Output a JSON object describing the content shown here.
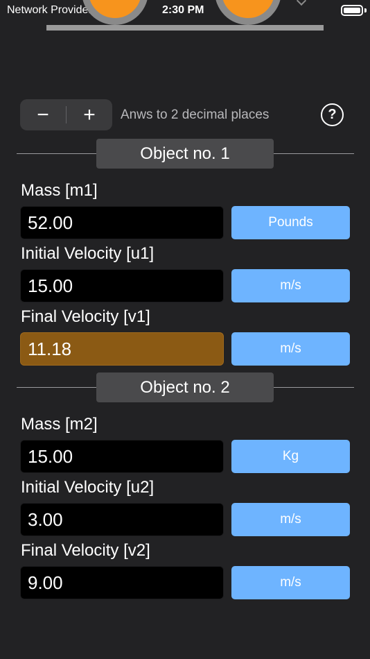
{
  "status_bar": {
    "carrier": "Network Provider",
    "time": "2:30 PM",
    "wifi_icon": "wifi-icon",
    "battery_icon": "battery-icon"
  },
  "illustration": {
    "ball_color": "#f7941d",
    "ring_color": "#8a8a8a"
  },
  "controls": {
    "decrement_label": "−",
    "increment_label": "+",
    "precision_text": "Anws to 2 decimal places",
    "help_label": "?"
  },
  "object1": {
    "title": "Object no. 1",
    "mass": {
      "label": "Mass [m1]",
      "value": "52.00",
      "unit": "Pounds"
    },
    "initial_velocity": {
      "label": "Initial Velocity [u1]",
      "value": "15.00",
      "unit": "m/s"
    },
    "final_velocity": {
      "label": "Final Velocity [v1]",
      "value": "11.18",
      "unit": "m/s"
    }
  },
  "object2": {
    "title": "Object no. 2",
    "mass": {
      "label": "Mass [m2]",
      "value": "15.00",
      "unit": "Kg"
    },
    "initial_velocity": {
      "label": "Initial Velocity [u2]",
      "value": "3.00",
      "unit": "m/s"
    },
    "final_velocity": {
      "label": "Final Velocity [v2]",
      "value": "9.00",
      "unit": "m/s"
    }
  },
  "colors": {
    "background": "#222224",
    "unit_button": "#6eb4ff",
    "result_field": "#8b5a14",
    "section_header": "#4a4a4c"
  }
}
